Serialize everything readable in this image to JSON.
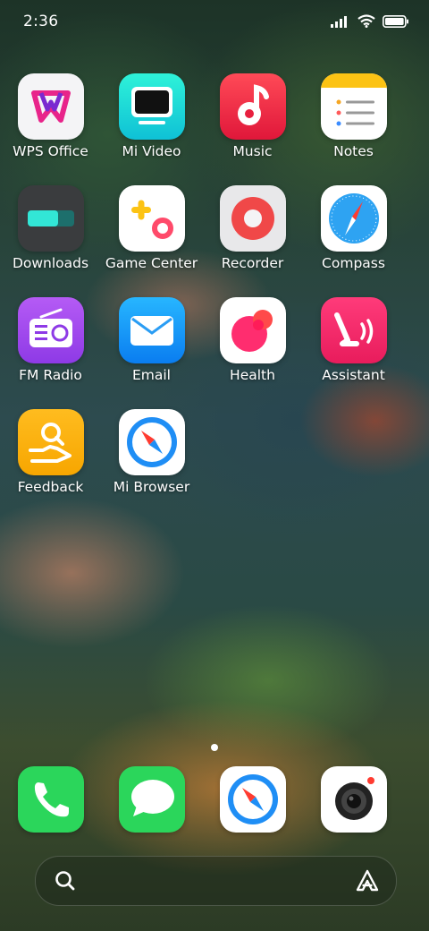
{
  "status": {
    "time": "2:36"
  },
  "apps": [
    {
      "label": "WPS Office",
      "icon": "wps-office-icon"
    },
    {
      "label": "Mi Video",
      "icon": "mi-video-icon"
    },
    {
      "label": "Music",
      "icon": "music-icon"
    },
    {
      "label": "Notes",
      "icon": "notes-icon"
    },
    {
      "label": "Downloads",
      "icon": "downloads-icon"
    },
    {
      "label": "Game Center",
      "icon": "game-center-icon"
    },
    {
      "label": "Recorder",
      "icon": "recorder-icon"
    },
    {
      "label": "Compass",
      "icon": "compass-icon"
    },
    {
      "label": "FM Radio",
      "icon": "fm-radio-icon"
    },
    {
      "label": "Email",
      "icon": "email-icon"
    },
    {
      "label": "Health",
      "icon": "health-icon"
    },
    {
      "label": "Assistant",
      "icon": "assistant-icon"
    },
    {
      "label": "Feedback",
      "icon": "feedback-icon"
    },
    {
      "label": "Mi Browser",
      "icon": "mi-browser-icon"
    }
  ],
  "dock": [
    {
      "icon": "phone-icon"
    },
    {
      "icon": "messages-icon"
    },
    {
      "icon": "browser-icon"
    },
    {
      "icon": "camera-icon"
    }
  ],
  "page_indicator": {
    "current": 1,
    "total": 1
  },
  "search": {
    "left_icon": "search-icon",
    "right_icon": "assistant-logo-icon"
  }
}
